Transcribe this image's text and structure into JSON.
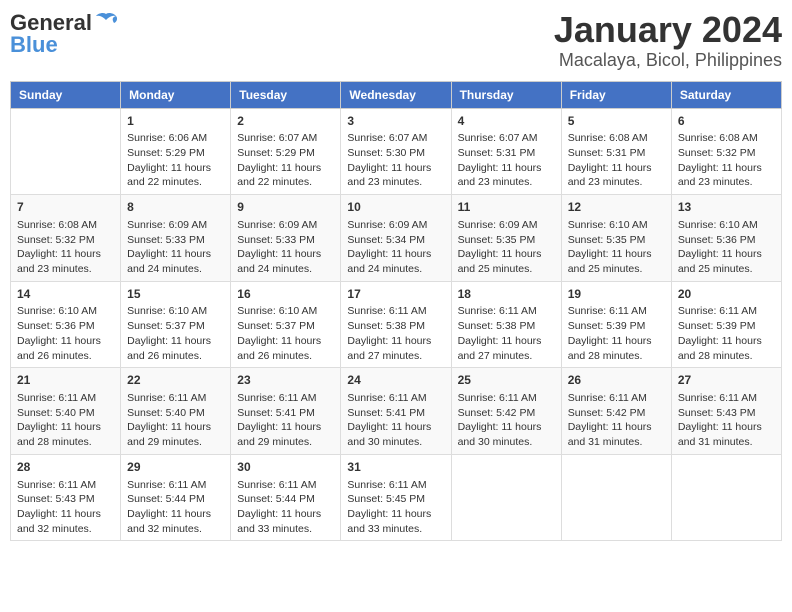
{
  "logo": {
    "line1": "General",
    "line2": "Blue"
  },
  "title": "January 2024",
  "subtitle": "Macalaya, Bicol, Philippines",
  "days_header": [
    "Sunday",
    "Monday",
    "Tuesday",
    "Wednesday",
    "Thursday",
    "Friday",
    "Saturday"
  ],
  "weeks": [
    [
      {
        "num": "",
        "info": ""
      },
      {
        "num": "1",
        "info": "Sunrise: 6:06 AM\nSunset: 5:29 PM\nDaylight: 11 hours\nand 22 minutes."
      },
      {
        "num": "2",
        "info": "Sunrise: 6:07 AM\nSunset: 5:29 PM\nDaylight: 11 hours\nand 22 minutes."
      },
      {
        "num": "3",
        "info": "Sunrise: 6:07 AM\nSunset: 5:30 PM\nDaylight: 11 hours\nand 23 minutes."
      },
      {
        "num": "4",
        "info": "Sunrise: 6:07 AM\nSunset: 5:31 PM\nDaylight: 11 hours\nand 23 minutes."
      },
      {
        "num": "5",
        "info": "Sunrise: 6:08 AM\nSunset: 5:31 PM\nDaylight: 11 hours\nand 23 minutes."
      },
      {
        "num": "6",
        "info": "Sunrise: 6:08 AM\nSunset: 5:32 PM\nDaylight: 11 hours\nand 23 minutes."
      }
    ],
    [
      {
        "num": "7",
        "info": "Sunrise: 6:08 AM\nSunset: 5:32 PM\nDaylight: 11 hours\nand 23 minutes."
      },
      {
        "num": "8",
        "info": "Sunrise: 6:09 AM\nSunset: 5:33 PM\nDaylight: 11 hours\nand 24 minutes."
      },
      {
        "num": "9",
        "info": "Sunrise: 6:09 AM\nSunset: 5:33 PM\nDaylight: 11 hours\nand 24 minutes."
      },
      {
        "num": "10",
        "info": "Sunrise: 6:09 AM\nSunset: 5:34 PM\nDaylight: 11 hours\nand 24 minutes."
      },
      {
        "num": "11",
        "info": "Sunrise: 6:09 AM\nSunset: 5:35 PM\nDaylight: 11 hours\nand 25 minutes."
      },
      {
        "num": "12",
        "info": "Sunrise: 6:10 AM\nSunset: 5:35 PM\nDaylight: 11 hours\nand 25 minutes."
      },
      {
        "num": "13",
        "info": "Sunrise: 6:10 AM\nSunset: 5:36 PM\nDaylight: 11 hours\nand 25 minutes."
      }
    ],
    [
      {
        "num": "14",
        "info": "Sunrise: 6:10 AM\nSunset: 5:36 PM\nDaylight: 11 hours\nand 26 minutes."
      },
      {
        "num": "15",
        "info": "Sunrise: 6:10 AM\nSunset: 5:37 PM\nDaylight: 11 hours\nand 26 minutes."
      },
      {
        "num": "16",
        "info": "Sunrise: 6:10 AM\nSunset: 5:37 PM\nDaylight: 11 hours\nand 26 minutes."
      },
      {
        "num": "17",
        "info": "Sunrise: 6:11 AM\nSunset: 5:38 PM\nDaylight: 11 hours\nand 27 minutes."
      },
      {
        "num": "18",
        "info": "Sunrise: 6:11 AM\nSunset: 5:38 PM\nDaylight: 11 hours\nand 27 minutes."
      },
      {
        "num": "19",
        "info": "Sunrise: 6:11 AM\nSunset: 5:39 PM\nDaylight: 11 hours\nand 28 minutes."
      },
      {
        "num": "20",
        "info": "Sunrise: 6:11 AM\nSunset: 5:39 PM\nDaylight: 11 hours\nand 28 minutes."
      }
    ],
    [
      {
        "num": "21",
        "info": "Sunrise: 6:11 AM\nSunset: 5:40 PM\nDaylight: 11 hours\nand 28 minutes."
      },
      {
        "num": "22",
        "info": "Sunrise: 6:11 AM\nSunset: 5:40 PM\nDaylight: 11 hours\nand 29 minutes."
      },
      {
        "num": "23",
        "info": "Sunrise: 6:11 AM\nSunset: 5:41 PM\nDaylight: 11 hours\nand 29 minutes."
      },
      {
        "num": "24",
        "info": "Sunrise: 6:11 AM\nSunset: 5:41 PM\nDaylight: 11 hours\nand 30 minutes."
      },
      {
        "num": "25",
        "info": "Sunrise: 6:11 AM\nSunset: 5:42 PM\nDaylight: 11 hours\nand 30 minutes."
      },
      {
        "num": "26",
        "info": "Sunrise: 6:11 AM\nSunset: 5:42 PM\nDaylight: 11 hours\nand 31 minutes."
      },
      {
        "num": "27",
        "info": "Sunrise: 6:11 AM\nSunset: 5:43 PM\nDaylight: 11 hours\nand 31 minutes."
      }
    ],
    [
      {
        "num": "28",
        "info": "Sunrise: 6:11 AM\nSunset: 5:43 PM\nDaylight: 11 hours\nand 32 minutes."
      },
      {
        "num": "29",
        "info": "Sunrise: 6:11 AM\nSunset: 5:44 PM\nDaylight: 11 hours\nand 32 minutes."
      },
      {
        "num": "30",
        "info": "Sunrise: 6:11 AM\nSunset: 5:44 PM\nDaylight: 11 hours\nand 33 minutes."
      },
      {
        "num": "31",
        "info": "Sunrise: 6:11 AM\nSunset: 5:45 PM\nDaylight: 11 hours\nand 33 minutes."
      },
      {
        "num": "",
        "info": ""
      },
      {
        "num": "",
        "info": ""
      },
      {
        "num": "",
        "info": ""
      }
    ]
  ]
}
